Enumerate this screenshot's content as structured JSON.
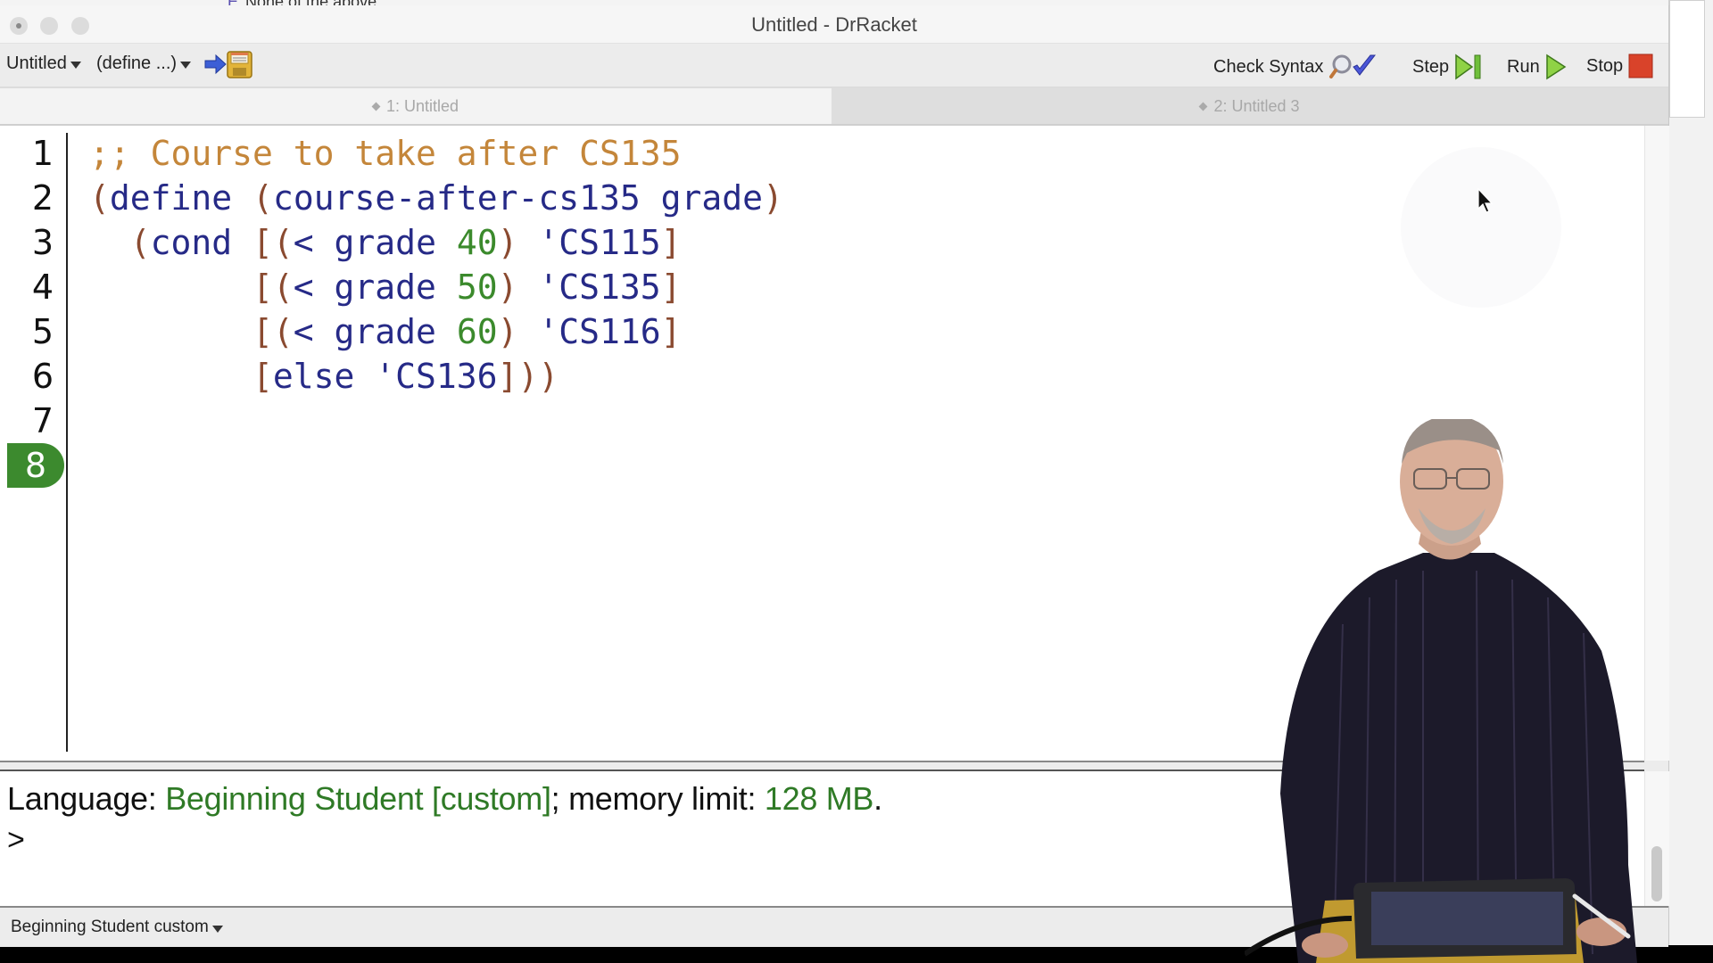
{
  "background_window": {
    "text": "None of the above"
  },
  "window": {
    "title": "Untitled - DrRacket"
  },
  "toolbar": {
    "file_menu": "Untitled",
    "define_menu": "(define ...)",
    "save_icon": "save-file-icon",
    "check_syntax": "Check Syntax",
    "step": "Step",
    "run": "Run",
    "stop": "Stop"
  },
  "tabs": [
    {
      "label": "1: Untitled",
      "active": true
    },
    {
      "label": "2: Untitled 3",
      "active": false
    }
  ],
  "editor": {
    "line_numbers": [
      "1",
      "2",
      "3",
      "4",
      "5",
      "6",
      "7",
      "8"
    ],
    "current_line": "8",
    "lines": [
      [
        {
          "t": ";; Course to take after CS135",
          "c": "com"
        }
      ],
      [
        {
          "t": "(",
          "c": "par"
        },
        {
          "t": "define ",
          "c": "id"
        },
        {
          "t": "(",
          "c": "par"
        },
        {
          "t": "course-after-cs135 grade",
          "c": "id"
        },
        {
          "t": ")",
          "c": "par"
        }
      ],
      [
        {
          "t": "  (",
          "c": "par"
        },
        {
          "t": "cond ",
          "c": "id"
        },
        {
          "t": "[(",
          "c": "par"
        },
        {
          "t": "< grade ",
          "c": "id"
        },
        {
          "t": "40",
          "c": "num"
        },
        {
          "t": ")",
          "c": "par"
        },
        {
          "t": " 'CS115",
          "c": "id"
        },
        {
          "t": "]",
          "c": "par"
        }
      ],
      [
        {
          "t": "        [(",
          "c": "par"
        },
        {
          "t": "< grade ",
          "c": "id"
        },
        {
          "t": "50",
          "c": "num"
        },
        {
          "t": ")",
          "c": "par"
        },
        {
          "t": " 'CS135",
          "c": "id"
        },
        {
          "t": "]",
          "c": "par"
        }
      ],
      [
        {
          "t": "        [(",
          "c": "par"
        },
        {
          "t": "< grade ",
          "c": "id"
        },
        {
          "t": "60",
          "c": "num"
        },
        {
          "t": ")",
          "c": "par"
        },
        {
          "t": " 'CS116",
          "c": "id"
        },
        {
          "t": "]",
          "c": "par"
        }
      ],
      [
        {
          "t": "        [",
          "c": "par"
        },
        {
          "t": "else 'CS136",
          "c": "id"
        },
        {
          "t": "]))",
          "c": "par"
        }
      ],
      [],
      []
    ]
  },
  "repl": {
    "language_label": "Language: ",
    "language_value": "Beginning Student [custom]",
    "memory_label": "; memory limit: ",
    "memory_value": "128 MB",
    "period": ".",
    "prompt": ">"
  },
  "statusbar": {
    "language": "Beginning Student custom"
  },
  "colors": {
    "comment": "#c4863a",
    "paren": "#8a4a30",
    "identifier": "#262a87",
    "number": "#3b8a2c",
    "current_line_badge": "#3c8a2e",
    "repl_green": "#2f7a26",
    "stop_red": "#d9432a",
    "run_green": "#7ac43a"
  }
}
